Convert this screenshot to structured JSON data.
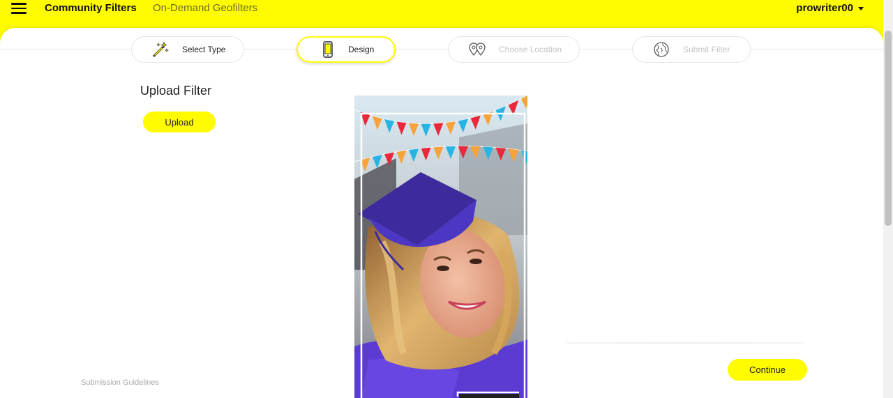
{
  "header": {
    "nav": {
      "community_filters": "Community Filters",
      "on_demand": "On-Demand Geofilters"
    },
    "username": "prowriter00"
  },
  "steps": [
    {
      "label": "Select Type",
      "icon": "magic-wand-icon",
      "state": "completed"
    },
    {
      "label": "Design",
      "icon": "phone-icon",
      "state": "active"
    },
    {
      "label": "Choose Location",
      "icon": "location-pins-icon",
      "state": "disabled"
    },
    {
      "label": "Submit Filter",
      "icon": "globe-icon",
      "state": "disabled"
    }
  ],
  "upload": {
    "title": "Upload Filter",
    "button": "Upload"
  },
  "footer": {
    "guidelines": "Submission Guidelines",
    "continue": "Continue"
  },
  "colors": {
    "brand_yellow": "#fffc00",
    "disabled_text": "#c3c3c3",
    "pennant_red": "#e8293b",
    "pennant_orange": "#f7a23a",
    "pennant_blue": "#27b4e2",
    "cap_purple": "#3d2a9c"
  }
}
